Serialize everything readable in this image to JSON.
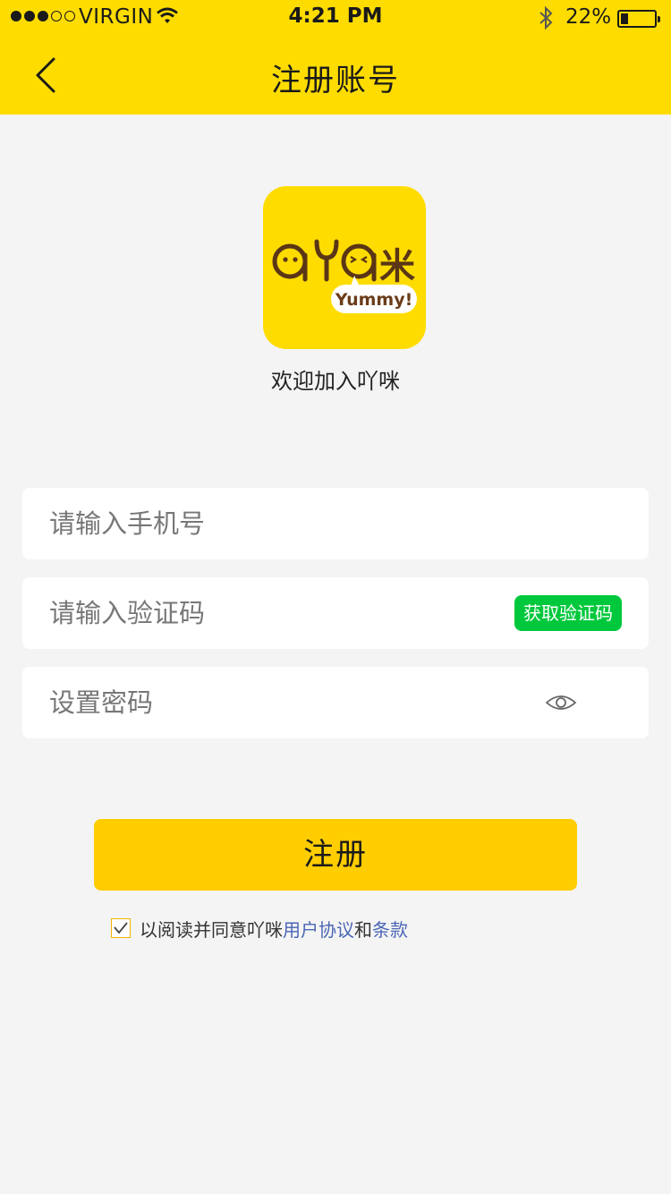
{
  "status_bar": {
    "carrier": "VIRGIN",
    "time": "4:21 PM",
    "battery_text": "22%",
    "battery_level": 0.22,
    "signal_bars_filled": 3,
    "signal_bars_total": 5
  },
  "header": {
    "title": "注册账号",
    "back_icon": "chevron-left-icon"
  },
  "brand": {
    "logo_text": "oYo咪",
    "logo_bubble_text": "Yummy!",
    "welcome": "欢迎加入吖咪"
  },
  "form": {
    "phone_placeholder": "请输入手机号",
    "code_placeholder": "请输入验证码",
    "get_code_label": "获取验证码",
    "password_placeholder": "设置密码",
    "password_toggle_icon": "eye-icon",
    "submit_label": "注册"
  },
  "agreement": {
    "checked": true,
    "prefix": "以阅读并同意吖咪",
    "terms_link": "用户协议",
    "connector": "和",
    "clauses_link": "条款"
  },
  "colors": {
    "brand_yellow": "#ffdc00",
    "button_yellow": "#ffcd00",
    "code_button_green": "#00c83c",
    "link_blue": "#4a66b5",
    "background": "#f4f4f4"
  }
}
